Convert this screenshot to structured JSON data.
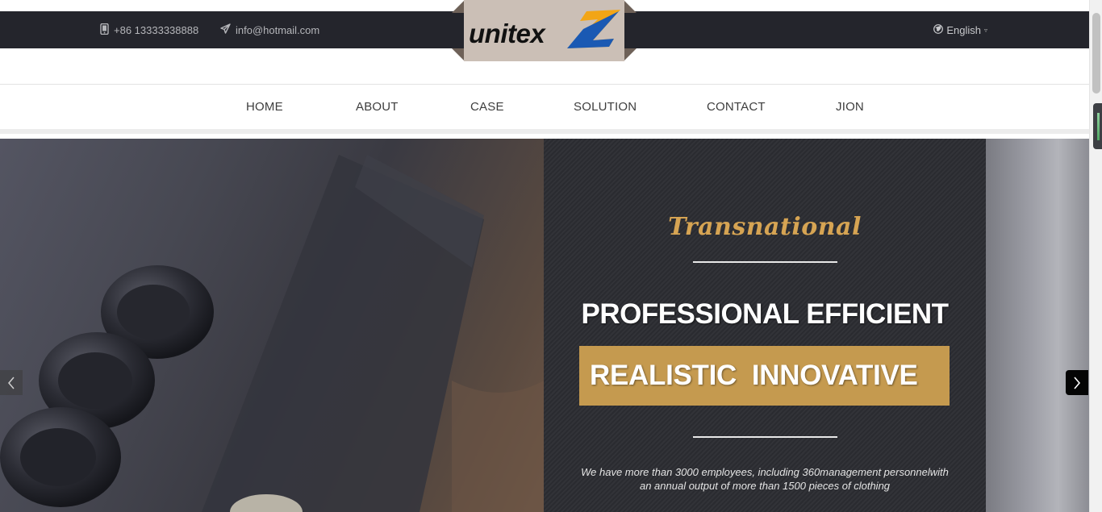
{
  "topbar": {
    "phone": "+86 13333338888",
    "email": "info@hotmail.com",
    "language": "English"
  },
  "logo": {
    "text": "unitex"
  },
  "nav": {
    "items": [
      {
        "label": "HOME"
      },
      {
        "label": "ABOUT"
      },
      {
        "label": "CASE"
      },
      {
        "label": "SOLUTION"
      },
      {
        "label": "CONTACT"
      },
      {
        "label": "JION"
      }
    ]
  },
  "hero": {
    "script_title": "Transnational",
    "headline": "PROFESSIONAL EFFICIENT",
    "band_text": "REALISTIC  INNOVATIVE",
    "description_line1": "We have more than 3000 employees, including 360management personnelwith",
    "description_line2": "an annual output of more than 1500 pieces of clothing"
  },
  "colors": {
    "topbar_bg": "#24252c",
    "accent_gold": "#c59a4f",
    "script_gold": "#d6a453",
    "logo_bg": "#cbbfb6"
  }
}
